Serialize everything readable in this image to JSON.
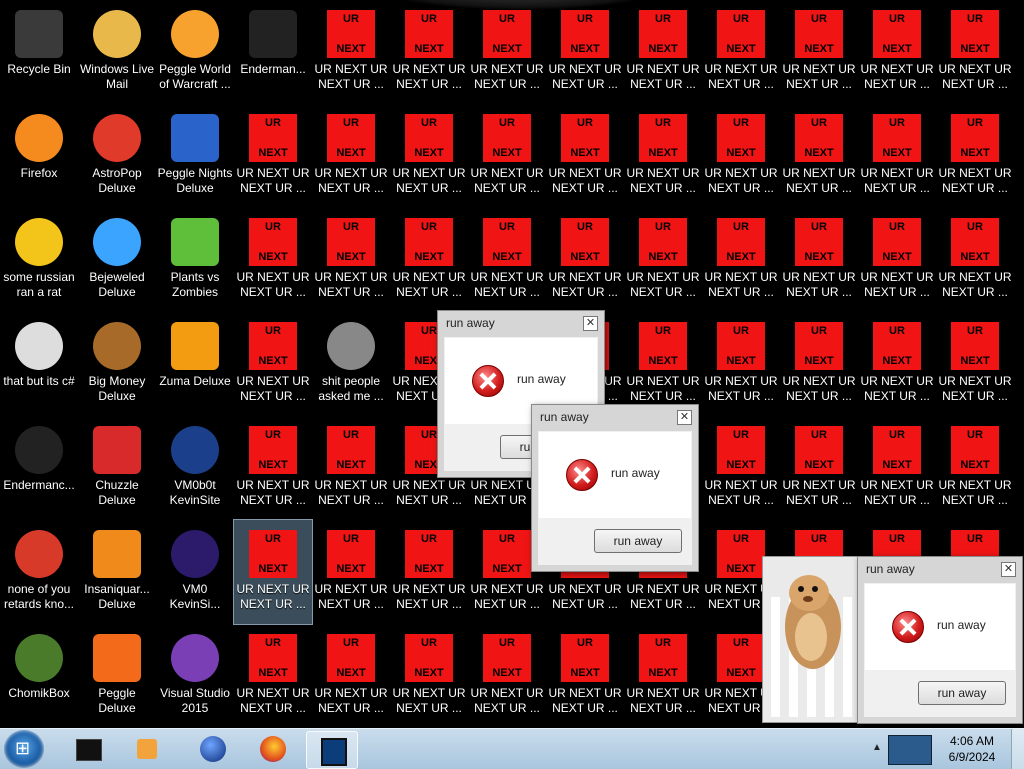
{
  "desktop": {
    "icons": [
      {
        "label": "Recycle Bin",
        "icon": "recycle-bin-icon"
      },
      {
        "label": "Windows Live\nMail",
        "icon": "mail-icon"
      },
      {
        "label": "Peggle World\nof Warcraft ...",
        "icon": "peggle-icon"
      },
      {
        "label": "Enderman...",
        "icon": "enderman-icon"
      },
      {
        "label": "Firefox",
        "icon": "firefox-icon"
      },
      {
        "label": "AstroPop\nDeluxe",
        "icon": "astropop-icon"
      },
      {
        "label": "Peggle Nights\nDeluxe",
        "icon": "peggle-nights-icon"
      },
      {
        "label": "some russian\nran a rat",
        "icon": "folder-icon"
      },
      {
        "label": "Bejeweled\nDeluxe",
        "icon": "bejeweled-icon"
      },
      {
        "label": "Plants vs\nZombies",
        "icon": "plants-vs-zombies-icon"
      },
      {
        "label": "that but its c#",
        "icon": "shortcut-icon"
      },
      {
        "label": "Big Money\nDeluxe",
        "icon": "big-money-icon"
      },
      {
        "label": "Zuma Deluxe",
        "icon": "zuma-icon"
      },
      {
        "label": "shit people\nasked me ...",
        "icon": "file-icon"
      },
      {
        "label": "Endermanc...",
        "icon": "enderman-icon"
      },
      {
        "label": "Chuzzle\nDeluxe",
        "icon": "chuzzle-icon"
      },
      {
        "label": "VM0b0t\nKevinSite",
        "icon": "vm-icon"
      },
      {
        "label": "none of you\nretards kno...",
        "icon": "app-icon"
      },
      {
        "label": "Insaniquar...\nDeluxe",
        "icon": "insaniquarium-icon"
      },
      {
        "label": "VM0\nKevinSi...",
        "icon": "vm-icon"
      },
      {
        "label": "ChomikBox",
        "icon": "chomikbox-icon"
      },
      {
        "label": "Peggle Deluxe",
        "icon": "peggle-icon"
      },
      {
        "label": "Visual Studio\n2015",
        "icon": "visual-studio-icon"
      }
    ],
    "ur_icon": {
      "top_text": "UR",
      "bottom_text": "NEXT",
      "label": "UR NEXT UR\nNEXT UR ..."
    }
  },
  "dialogs": [
    {
      "title": "run away",
      "message": "run away",
      "button": "run away"
    },
    {
      "title": "run away",
      "message": "run away",
      "button": "run away"
    },
    {
      "title": "run away",
      "message": "run away",
      "button": "run away"
    }
  ],
  "taskbar": {
    "start": "⊞",
    "pinned": [
      "cmd-icon",
      "media-player-icon",
      "globe-icon",
      "firefox-icon",
      "app-icon"
    ],
    "clock": {
      "time": "4:06 AM",
      "date": "6/9/2024"
    }
  },
  "colors": {
    "ur_red": "#f01414",
    "taskbar": "#b9d1e6"
  }
}
